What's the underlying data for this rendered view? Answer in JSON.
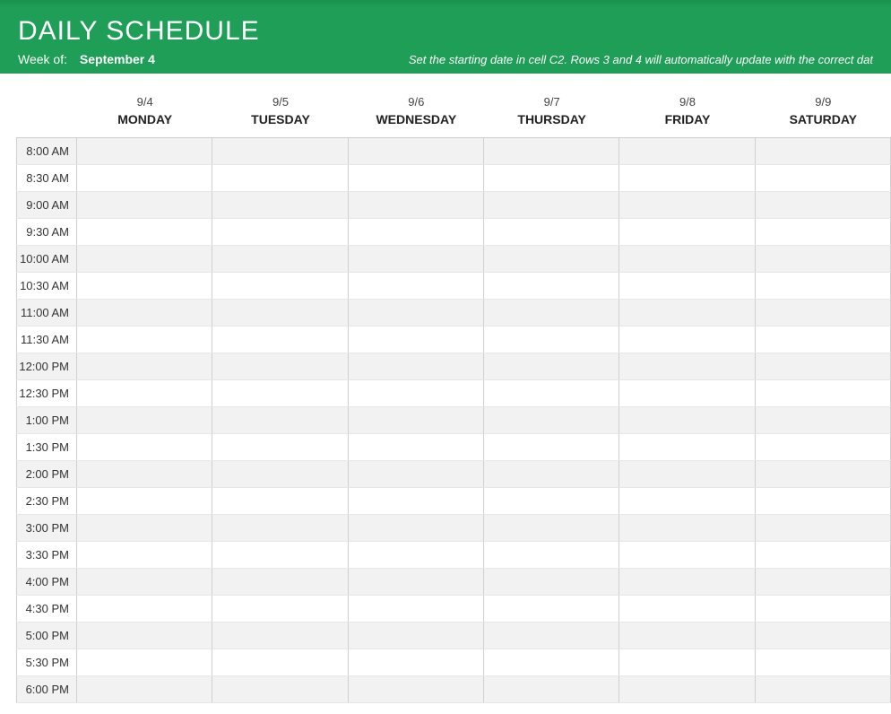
{
  "header": {
    "title": "DAILY SCHEDULE",
    "weekof_label": "Week of:",
    "weekof_date": "September 4",
    "hint": "Set the starting date in cell C2. Rows 3 and 4 will automatically update with the correct dat"
  },
  "days": [
    {
      "date": "9/4",
      "name": "MONDAY"
    },
    {
      "date": "9/5",
      "name": "TUESDAY"
    },
    {
      "date": "9/6",
      "name": "WEDNESDAY"
    },
    {
      "date": "9/7",
      "name": "THURSDAY"
    },
    {
      "date": "9/8",
      "name": "FRIDAY"
    },
    {
      "date": "9/9",
      "name": "SATURDAY"
    }
  ],
  "times": [
    "8:00 AM",
    "8:30 AM",
    "9:00 AM",
    "9:30 AM",
    "10:00 AM",
    "10:30 AM",
    "11:00 AM",
    "11:30 AM",
    "12:00 PM",
    "12:30 PM",
    "1:00 PM",
    "1:30 PM",
    "2:00 PM",
    "2:30 PM",
    "3:00 PM",
    "3:30 PM",
    "4:00 PM",
    "4:30 PM",
    "5:00 PM",
    "5:30 PM",
    "6:00 PM"
  ]
}
